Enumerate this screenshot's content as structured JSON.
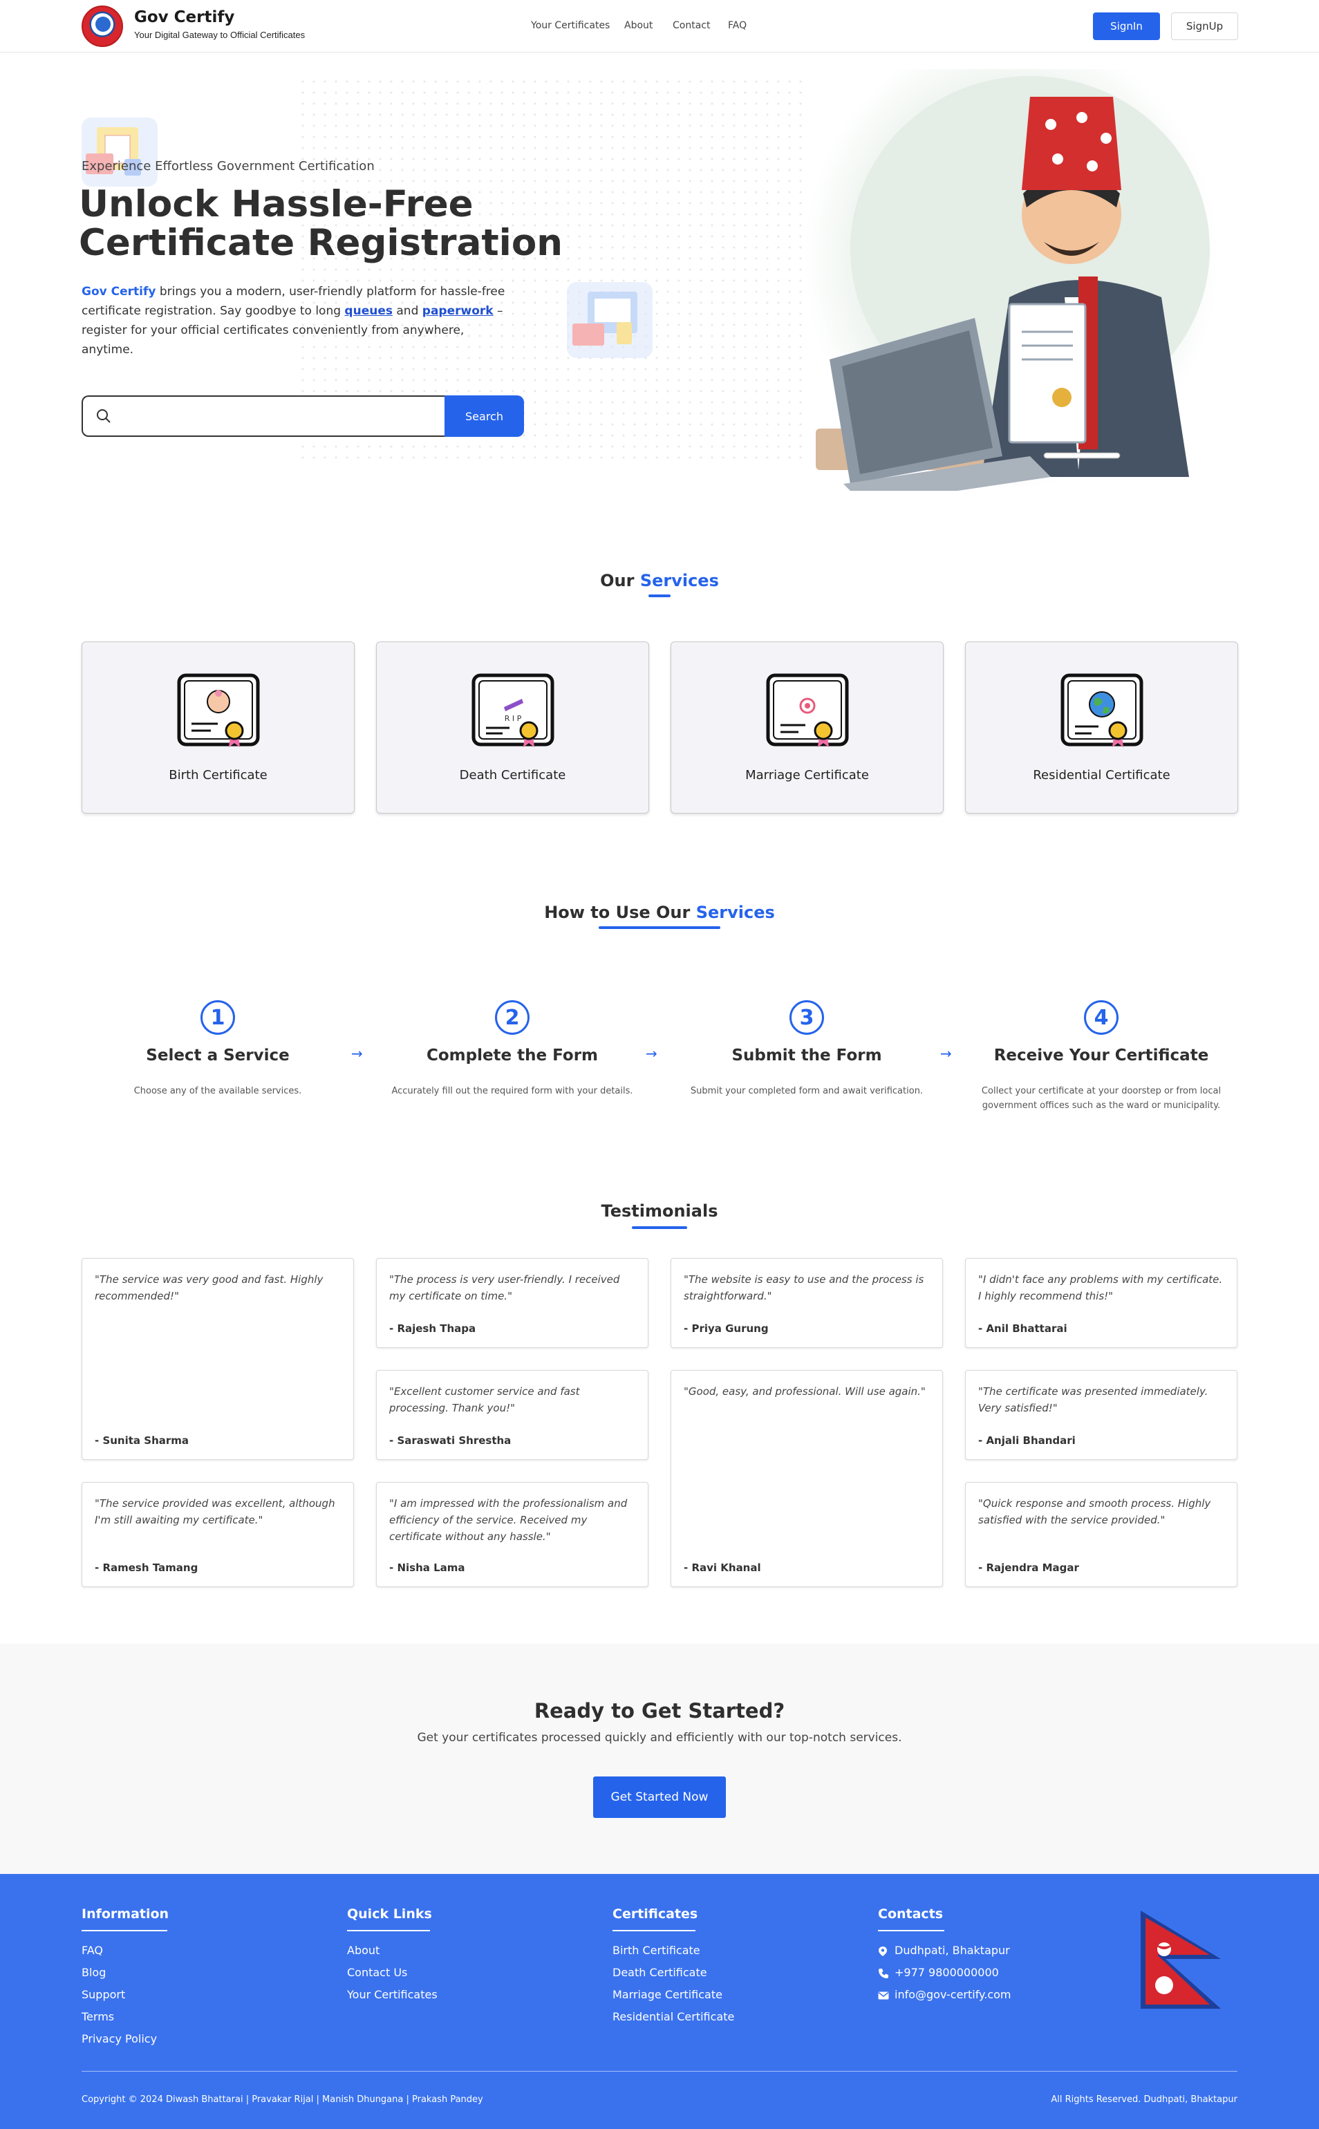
{
  "nav": {
    "brand": "Gov Certify",
    "tagline": "Your Digital Gateway to Official Certificates",
    "links": [
      "Your Certificates",
      "About",
      "Contact",
      "FAQ"
    ],
    "signin": "SignIn",
    "signup": "SignUp"
  },
  "hero": {
    "subtitle": "Experience Effortless Government Certification",
    "title": "Unlock Hassle-Free Certificate Registration",
    "desc_brand": "Gov Certify",
    "desc_1": " brings you a modern, user-friendly platform for hassle-free certificate registration. Say goodbye to long ",
    "desc_queues": "queues",
    "desc_and": " and ",
    "desc_paperwork": "paperwork",
    "desc_2": " – register for your official certificates conveniently from anywhere, anytime.",
    "search_placeholder": "",
    "search_button": "Search"
  },
  "services": {
    "title_prefix": "Our",
    "title_accent": "Services",
    "items": [
      "Birth Certificate",
      "Death Certificate",
      "Marriage Certificate",
      "Residential Certificate"
    ]
  },
  "howto": {
    "title_prefix": "How to Use Our",
    "title_accent": "Services",
    "steps": [
      {
        "num": "1",
        "title": "Select a Service",
        "desc": "Choose any of the available services."
      },
      {
        "num": "2",
        "title": "Complete the Form",
        "desc": "Accurately fill out the required form with your details."
      },
      {
        "num": "3",
        "title": "Submit the Form",
        "desc": "Submit your completed form and await verification."
      },
      {
        "num": "4",
        "title": "Receive Your Certificate",
        "desc": "Collect your certificate at your doorstep or from local government offices such as the ward or municipality."
      }
    ]
  },
  "testimonials": {
    "title": "Testimonials",
    "items": [
      {
        "quote": "\"The service was very good and fast. Highly recommended!\"",
        "author": "- Sunita Sharma"
      },
      {
        "quote": "\"The process is very user-friendly. I received my certificate on time.\"",
        "author": "- Rajesh Thapa"
      },
      {
        "quote": "\"The website is easy to use and the process is straightforward.\"",
        "author": "- Priya Gurung"
      },
      {
        "quote": "\"I didn't face any problems with my certificate. I highly recommend this!\"",
        "author": "- Anil Bhattarai"
      },
      {
        "quote": "\"Excellent customer service and fast processing. Thank you!\"",
        "author": "- Saraswati Shrestha"
      },
      {
        "quote": "\"Good, easy, and professional. Will use again.\"",
        "author": "- Ravi Khanal"
      },
      {
        "quote": "\"The certificate was presented immediately. Very satisfied!\"",
        "author": "- Anjali Bhandari"
      },
      {
        "quote": "\"The service provided was excellent, although I'm still awaiting my certificate.\"",
        "author": "- Ramesh Tamang"
      },
      {
        "quote": "\"I am impressed with the professionalism and efficiency of the service. Received my certificate without any hassle.\"",
        "author": "- Nisha Lama"
      },
      {
        "quote": "\"Quick response and smooth process. Highly satisfied with the service provided.\"",
        "author": "- Rajendra Magar"
      }
    ]
  },
  "cta": {
    "title": "Ready to Get Started?",
    "subtitle": "Get your certificates processed quickly and efficiently with our top-notch services.",
    "button": "Get Started Now"
  },
  "footer": {
    "information": {
      "title": "Information",
      "links": [
        "FAQ",
        "Blog",
        "Support",
        "Terms",
        "Privacy Policy"
      ]
    },
    "quick_links": {
      "title": "Quick Links",
      "links": [
        "About",
        "Contact Us",
        "Your Certificates"
      ]
    },
    "certificates": {
      "title": "Certificates",
      "links": [
        "Birth Certificate",
        "Death Certificate",
        "Marriage Certificate",
        "Residential Certificate"
      ]
    },
    "contacts": {
      "title": "Contacts",
      "address": "Dudhpati, Bhaktapur",
      "phone": "+977 9800000000",
      "email": "info@gov-certify.com"
    },
    "copyright": "Copyright © 2024 Diwash Bhattarai | Pravakar Rijal | Manish Dhungana | Prakash Pandey",
    "rights": "All Rights Reserved. Dudhpati, Bhaktapur"
  },
  "colors": {
    "accent": "#2563eb",
    "footer_bg": "#3a72ee"
  }
}
